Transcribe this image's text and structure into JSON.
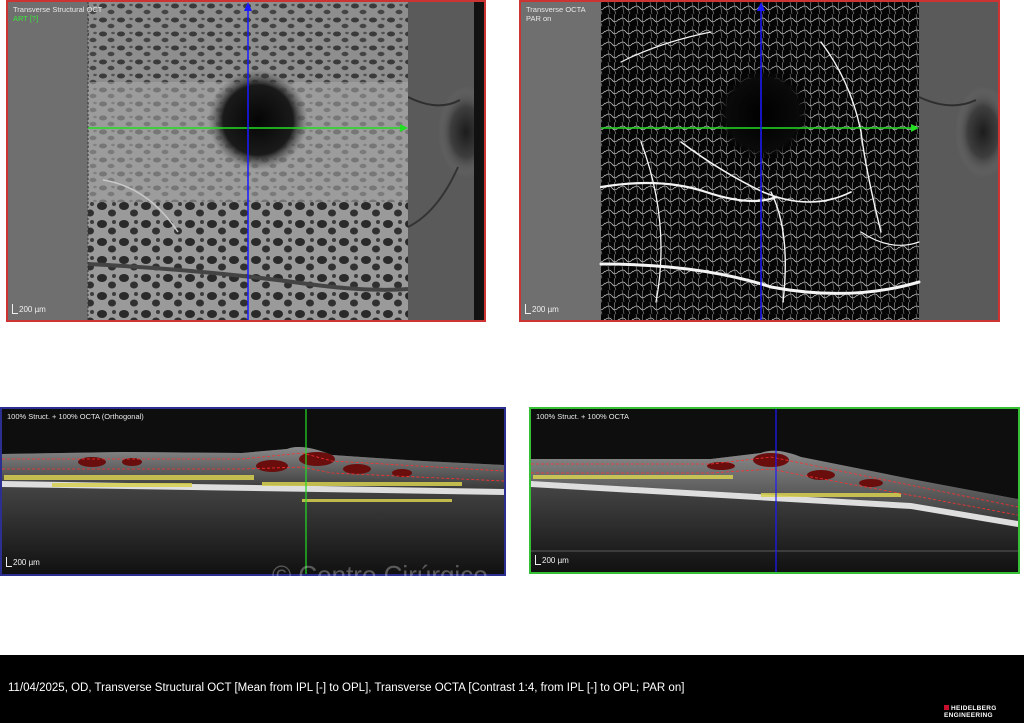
{
  "panels": {
    "structural_oct": {
      "label": "Transverse Structural OCT",
      "sublabel": "ART [?]",
      "scale": "200 µm",
      "border_color": "#cc3434",
      "cursor_colors": {
        "horizontal": "#22dd22",
        "vertical": "#1a1aff"
      }
    },
    "octa": {
      "label": "Transverse OCTA",
      "sublabel": "PAR on",
      "scale": "200 µm",
      "border_color": "#cc3434",
      "cursor_colors": {
        "horizontal": "#22dd22",
        "vertical": "#1a1aff"
      }
    },
    "bscan_orthogonal": {
      "label": "100% Struct. + 100% OCTA (Orthogonal)",
      "scale": "200 µm",
      "border_color": "#2b2f8f",
      "cursor_color": "#22dd22"
    },
    "bscan": {
      "label": "100% Struct. + 100% OCTA",
      "scale": "200 µm",
      "border_color": "#35c035",
      "cursor_color": "#1a1aff"
    }
  },
  "watermark": "© Centro Cirúrgico",
  "footer": {
    "caption": "11/04/2025, OD, Transverse Structural OCT [Mean from IPL [-] to OPL], Transverse OCTA [Contrast 1:4, from IPL [-] to OPL; PAR on]",
    "logo_line1": "HEIDELBERG",
    "logo_line2": "ENGINEERING"
  },
  "colors": {
    "flow_overlay": "#e8e020",
    "fluid_overlay": "#8a1010",
    "segmentation_lines": "#ff3030"
  }
}
